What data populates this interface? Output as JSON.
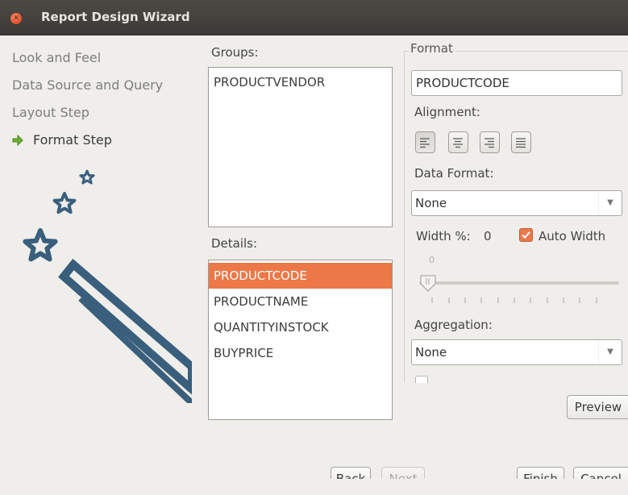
{
  "window": {
    "title": "Report Design Wizard"
  },
  "steps": [
    {
      "label": "Look and Feel",
      "active": false
    },
    {
      "label": "Data Source and Query",
      "active": false
    },
    {
      "label": "Layout Step",
      "active": false
    },
    {
      "label": "Format Step",
      "active": true
    }
  ],
  "groups": {
    "label": "Groups:",
    "items": [
      "PRODUCTVENDOR"
    ]
  },
  "details": {
    "label": "Details:",
    "items": [
      "PRODUCTCODE",
      "PRODUCTNAME",
      "QUANTITYINSTOCK",
      "BUYPRICE"
    ],
    "selected": "PRODUCTCODE"
  },
  "format": {
    "legend": "Format",
    "field_value": "PRODUCTCODE",
    "alignment_label": "Alignment:",
    "alignment_options": [
      "align-left",
      "align-center",
      "align-right",
      "align-justify"
    ],
    "alignment_selected": "align-left",
    "data_format_label": "Data Format:",
    "data_format_value": "None",
    "width_label": "Width %:",
    "width_value": "0",
    "slider_value": "0",
    "auto_width_label": "Auto Width",
    "auto_width_checked": true,
    "aggregation_label": "Aggregation:",
    "aggregation_value": "None"
  },
  "buttons": {
    "preview": "Preview",
    "back": "Back",
    "next": "Next",
    "finish": "Finish",
    "cancel": "Cancel"
  },
  "colors": {
    "accent": "#ec7848",
    "art": "#3a5f7d",
    "step_arrow": "#6fae38"
  }
}
